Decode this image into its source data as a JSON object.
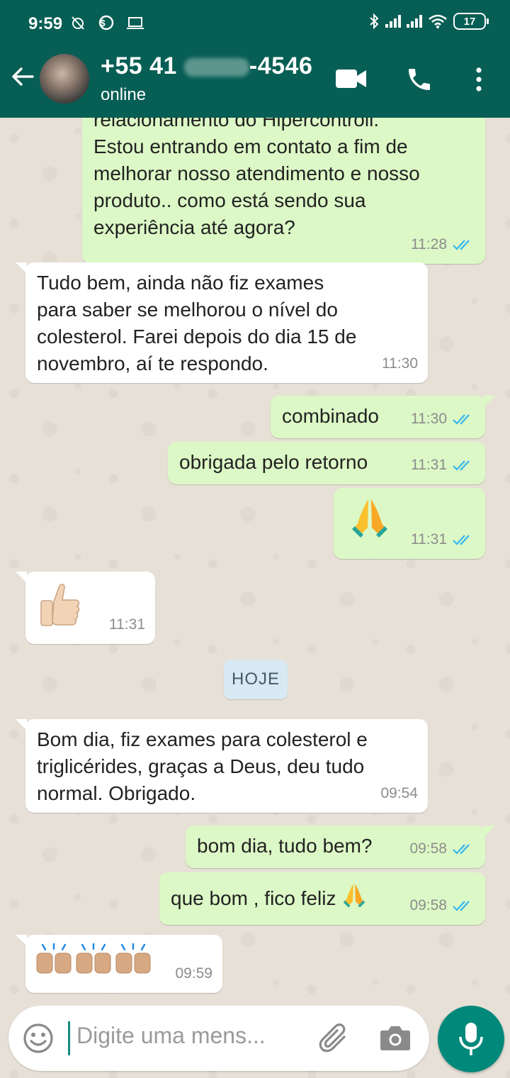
{
  "status_bar": {
    "time": "9:59",
    "battery": "17"
  },
  "header": {
    "contact_prefix": "+55 41",
    "contact_suffix": "-4546",
    "status": "online"
  },
  "messages": [
    {
      "direction": "out",
      "text_lines": [
        "relacionamento do Hipercontroll.",
        "Estou entrando em contato a fim de",
        "melhorar nosso atendimento e nosso",
        "produto.. como está sendo sua",
        "experiência até agora?"
      ],
      "time": "11:28",
      "read": true
    },
    {
      "direction": "in",
      "text_lines": [
        "Tudo bem, ainda não fiz exames",
        "para saber se melhorou o nível do",
        "colesterol. Farei depois do dia 15 de",
        "novembro, aí te respondo."
      ],
      "time": "11:30"
    },
    {
      "direction": "out",
      "text": "combinado",
      "time": "11:30",
      "read": true
    },
    {
      "direction": "out",
      "text": "obrigada pelo retorno",
      "time": "11:31",
      "read": true
    },
    {
      "direction": "out",
      "emoji": "folded-hands",
      "time": "11:31",
      "read": true
    },
    {
      "direction": "in",
      "emoji": "thumbs-up",
      "time": "11:31"
    },
    {
      "direction": "in",
      "text_lines": [
        "Bom dia, fiz exames para colesterol e",
        "triglicérides, graças a Deus, deu tudo",
        "normal. Obrigado."
      ],
      "time": "09:54"
    },
    {
      "direction": "out",
      "text": "bom dia, tudo bem?",
      "time": "09:58",
      "read": true
    },
    {
      "direction": "out",
      "text": "que bom , fico feliz",
      "emoji": "folded-hands",
      "time": "09:58",
      "read": true
    },
    {
      "direction": "in",
      "emoji": "raising-hands x3",
      "time": "09:59"
    }
  ],
  "date_divider": "HOJE",
  "composer": {
    "placeholder": "Digite uma mens..."
  },
  "colors": {
    "header": "#075e54",
    "outgoing_bubble": "#dcf8c6",
    "incoming_bubble": "#ffffff",
    "read_ticks": "#34b7f1",
    "mic_button": "#00897b"
  }
}
